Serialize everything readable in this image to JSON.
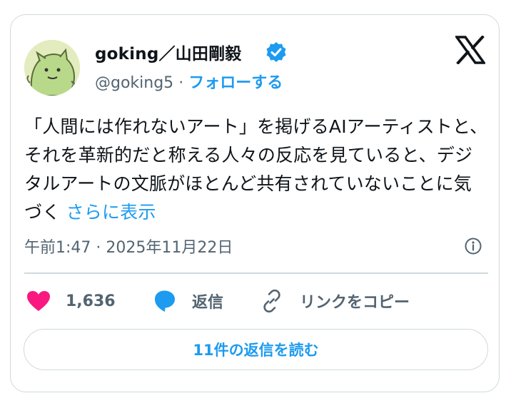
{
  "author": {
    "display_name": "goking／山田剛毅",
    "handle": "@goking5",
    "separator": "·",
    "follow_label": "フォローする"
  },
  "tweet": {
    "text": "「人間には作れないアート」を掲げるAIアーティストと、それを革新的だと称える人々の反応を見ていると、デジタルアートの文脈がほとんど共有されていないことに気づく",
    "show_more_label": "さらに表示",
    "timestamp": "午前1:47 · 2025年11月22日"
  },
  "actions": {
    "like_count": "1,636",
    "reply_label": "返信",
    "copy_link_label": "リンクをコピー"
  },
  "read_replies_label": "11件の返信を読む",
  "colors": {
    "accent": "#1d9bf0",
    "like": "#f91880",
    "text": "#0f1419",
    "secondary": "#536471",
    "border": "#cfd9de"
  },
  "icons": [
    "avatar-character",
    "verified-badge-icon",
    "x-logo-icon",
    "info-icon",
    "heart-icon",
    "reply-bubble-icon",
    "link-icon"
  ]
}
